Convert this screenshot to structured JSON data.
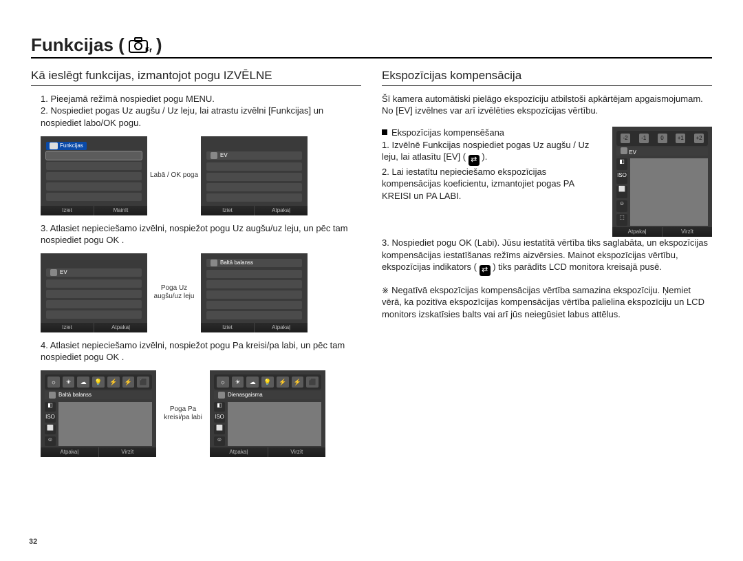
{
  "page_number": "32",
  "title_prefix": "Funkcijas (",
  "title_suffix": " )",
  "left": {
    "subheading": "Kā ieslēgt funkcijas, izmantojot pogu IZVĒLNE",
    "steps": {
      "s1": "1. Pieejamā režīmā nospiediet pogu MENU.",
      "s2": "2. Nospiediet pogas Uz augšu / Uz leju, lai atrastu izvēlni [Funkcijas] un nospiediet labo/OK pogu.",
      "s3": "3. Atlasiet nepieciešamo izvēlni, nospiežot pogu Uz augšu/uz leju, un pēc tam nospiediet pogu OK .",
      "s4": "4. Atlasiet nepieciešamo izvēlni, nospiežot pogu Pa kreisi/pa labi, un pēc tam nospiediet pogu OK ."
    },
    "labels": {
      "between12": "Labā / OK poga",
      "between34": "Poga Uz augšu/uz leju",
      "between56": "Poga Pa kreisi/pa labi"
    },
    "fig1": {
      "tag": "Funkcijas",
      "bottom_left": "Iziet",
      "bottom_right": "Mainīt"
    },
    "fig2": {
      "row_label": "EV",
      "bottom_left": "Iziet",
      "bottom_right": "Atpakaļ"
    },
    "fig3": {
      "row_label": "EV",
      "bottom_left": "Iziet",
      "bottom_right": "Atpakaļ"
    },
    "fig4": {
      "row_label": "Baltā balanss",
      "bottom_left": "Iziet",
      "bottom_right": "Atpakaļ"
    },
    "fig5": {
      "label": "Baltā balanss",
      "bottom_left": "Atpakaļ",
      "bottom_right": "Virzīt"
    },
    "fig6": {
      "label": "Dienasgaisma",
      "bottom_left": "Atpakaļ",
      "bottom_right": "Virzīt"
    }
  },
  "right": {
    "subheading": "Ekspozīcijas kompensācija",
    "intro": "Šī kamera automātiski pielāgo ekspozīciju atbilstoši apkārtējam apgaismojumam. No [EV] izvēlnes var arī izvēlēties ekspozīcijas vērtību.",
    "bullet": "Ekspozīcijas kompensēšana",
    "steps": {
      "s1a": "1. Izvēlnē Funkcijas nospiediet pogas Uz augšu / Uz leju, lai atlasītu [EV] (",
      "s1b": " ).",
      "s2": "2. Lai iestatītu nepieciešamo ekspozīcijas kompensācijas koeficientu, izmantojiet pogas PA KREISI un PA LABI.",
      "s3a": "3. Nospiediet pogu OK (Labi). Jūsu iestatītā vērtība tiks saglabāta, un ekspozīcijas kompensācijas iestatīšanas režīms aizvērsies. Mainot ekspozīcijas vērtību, ekspozīcijas indikators (",
      "s3b": " ) tiks parādīts LCD monitora kreisajā pusē."
    },
    "note": "Negatīvā ekspozīcijas kompensācijas vērtība samazina ekspozīciju. Ņemiet vērā, ka pozitīva ekspozīcijas kompensācijas vērtība palielina ekspozīciju un LCD monitors izskatīsies balts vai arī jūs neiegūsiet labus attēlus.",
    "fig": {
      "scale": [
        "-2",
        "-1",
        "0",
        "+1",
        "+2"
      ],
      "row_label": "EV",
      "bottom_left": "Atpakaļ",
      "bottom_right": "Virzīt"
    }
  }
}
